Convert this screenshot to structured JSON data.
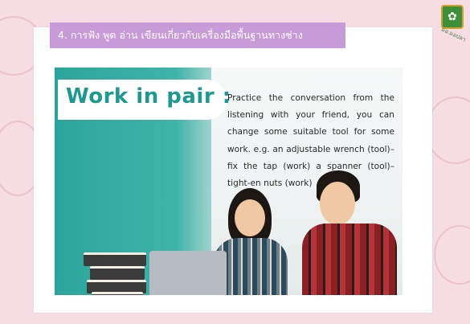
{
  "topic_bar": {
    "text": "4. การฟัง พูด อ่าน เขียนเกี่ยวกับเครื่องมือพื้นฐานทางช่าง"
  },
  "heading": {
    "text": "Work in pair :"
  },
  "instructions": {
    "text": "Practice the conversation from the listening with your friend, you can change some suitable tool for some work. e.g. an adjustable wrench (tool)– fix the tap (work) a spanner (tool)–tight-en nuts (work)"
  },
  "logo": {
    "icon": "school-emblem-icon",
    "caption": "มอ.มอปลา"
  },
  "colors": {
    "topic_bar": "#c79ad8",
    "heading": "#1d9a90",
    "background": "#f6dde3"
  },
  "photo": {
    "icon": "students-with-laptop-photo"
  }
}
